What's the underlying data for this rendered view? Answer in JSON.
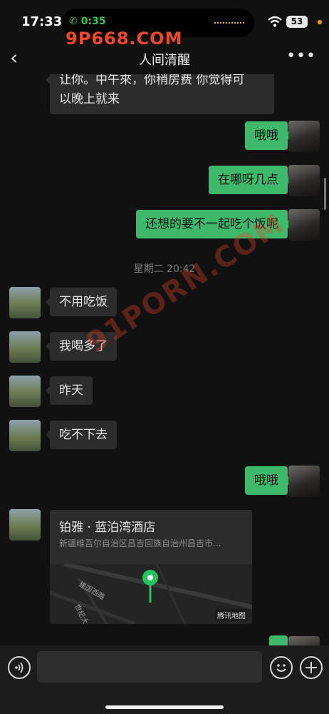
{
  "status": {
    "time": "17:33",
    "call_timer": "0:35",
    "battery": "53"
  },
  "watermark": {
    "top": "9P668.COM",
    "diagonal": "91PORN.COM"
  },
  "nav": {
    "back": "‹",
    "title": "人间清醒",
    "more": "•••"
  },
  "messages": {
    "m0": "让你。中午來，你稍房费 你觉得可",
    "m0b": "以晚上就来",
    "m1": "哦哦",
    "m2": "在哪呀几点",
    "m3": "还想的要不一起吃个饭呢",
    "timestamp": "星期二 20:42",
    "m4": "不用吃饭",
    "m5": "我喝多了",
    "m6": "昨天",
    "m7": "吃不下去",
    "m8": "哦哦"
  },
  "location": {
    "name": "铂雅 · 蓝泊湾酒店",
    "address": "新疆维吾尔自治区昌吉回族自治州昌吉市...",
    "road1": "建国西路",
    "road2": "世纪大",
    "map_brand": "腾讯地图"
  },
  "input": {
    "placeholder": ""
  },
  "colors": {
    "outgoing": "#3eb96b",
    "incoming": "#2c2c2c",
    "background": "#111111"
  },
  "icons": [
    "voice-icon",
    "emoji-icon",
    "plus-icon",
    "back-icon",
    "more-icon"
  ]
}
